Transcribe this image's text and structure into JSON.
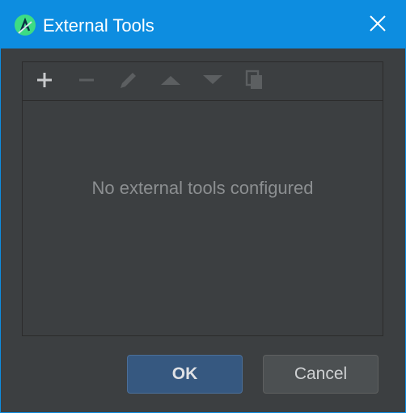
{
  "window": {
    "title": "External Tools"
  },
  "toolbar": {
    "buttons": [
      {
        "name": "add-icon",
        "enabled": true
      },
      {
        "name": "remove-icon",
        "enabled": false
      },
      {
        "name": "edit-icon",
        "enabled": false
      },
      {
        "name": "move-up-icon",
        "enabled": false
      },
      {
        "name": "move-down-icon",
        "enabled": false
      },
      {
        "name": "copy-icon",
        "enabled": false
      }
    ]
  },
  "list": {
    "empty_text": "No external tools configured",
    "items": []
  },
  "footer": {
    "ok_label": "OK",
    "cancel_label": "Cancel"
  },
  "colors": {
    "titlebar": "#0d8de0",
    "background": "#3c3f41",
    "primary_button": "#365880"
  }
}
